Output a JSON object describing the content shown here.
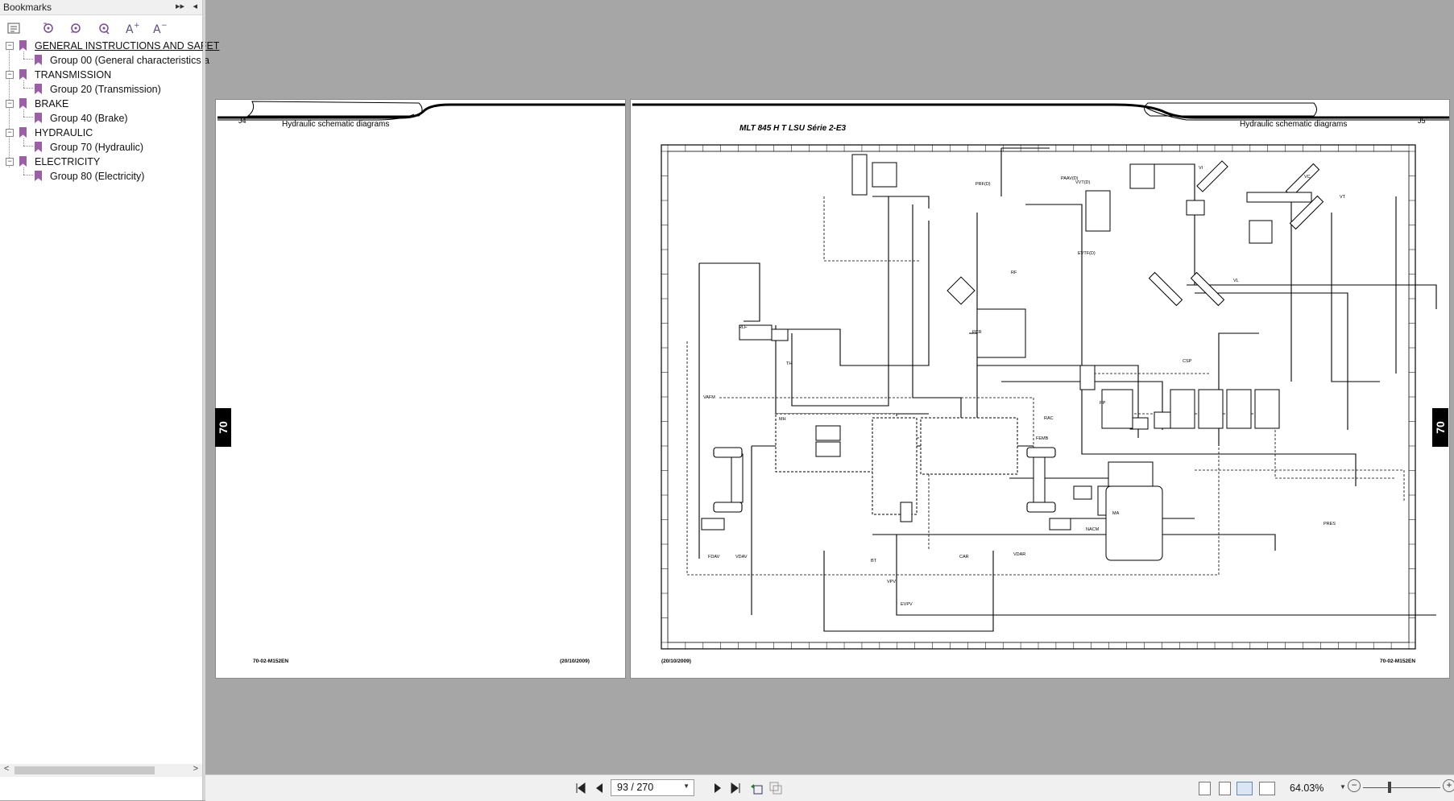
{
  "sidebar": {
    "title": "Bookmarks",
    "controls": [
      "▸▸",
      "◂"
    ],
    "tree": [
      {
        "label": "GENERAL INSTRUCTIONS AND SAFET",
        "child": "Group 00 (General characteristics a"
      },
      {
        "label": "TRANSMISSION",
        "child": "Group 20 (Transmission)"
      },
      {
        "label": "BRAKE",
        "child": "Group 40 (Brake)"
      },
      {
        "label": "HYDRAULIC",
        "child": "Group 70 (Hydraulic)"
      },
      {
        "label": "ELECTRICITY",
        "child": "Group 80 (Electricity)"
      }
    ]
  },
  "left_page": {
    "header_title": "Hydraulic schematic diagrams",
    "page_id": "J4",
    "footer_left": "70-02-M152EN",
    "footer_right": "(20/10/2009)",
    "section_tab": "70"
  },
  "right_page": {
    "header_title": "Hydraulic schematic diagrams",
    "page_id": "J5",
    "model": "MLT 845 H T LSU Série 2-E3",
    "footer_left": "(20/10/2009)",
    "footer_right": "70-02-M152EN",
    "section_tab": "70",
    "schematic_labels": [
      "PRF(D)",
      "RF",
      "PCR",
      "VI",
      "VC",
      "VT",
      "VL",
      "CSP",
      "MH",
      "BT",
      "VPV",
      "EVPV",
      "VDAV",
      "FDAV",
      "VDAR",
      "CAR",
      "RAC",
      "FEMB",
      "PP",
      "MA",
      "NACM",
      "PRES",
      "VAFM",
      "TH",
      "RLF",
      "PAAV(D)",
      "EVTF(D)",
      "VVT(D)"
    ]
  },
  "statusbar": {
    "page_indicator": "93 / 270",
    "zoom": "64.03%"
  }
}
